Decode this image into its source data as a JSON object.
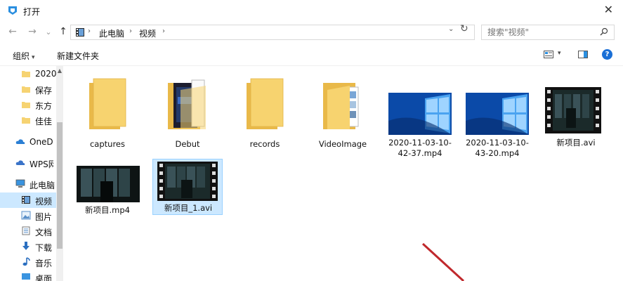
{
  "window": {
    "title": "打开",
    "close_glyph": "✕"
  },
  "nav": {
    "back": "←",
    "forward": "→",
    "recent": "⌄",
    "up": "↑"
  },
  "address": {
    "crumbs": [
      "此电脑",
      "视频"
    ],
    "sep": "›",
    "dropdown": "⌄",
    "refresh": "↻"
  },
  "search": {
    "placeholder": "搜索\"视频\""
  },
  "toolbar": {
    "organize_label": "组织",
    "organize_caret": "▾",
    "new_folder_label": "新建文件夹",
    "view_caret": "▾",
    "help_glyph": "?"
  },
  "sidebar": {
    "items": [
      {
        "label": "2020",
        "icon": "folder-icon"
      },
      {
        "label": "保存",
        "icon": "folder-icon"
      },
      {
        "label": "东方",
        "icon": "folder-icon"
      },
      {
        "label": "佳佳",
        "icon": "folder-icon"
      },
      {
        "label": "OneD",
        "icon": "cloud-icon"
      },
      {
        "label": "WPS网",
        "icon": "cloud-icon"
      },
      {
        "label": "此电脑",
        "icon": "computer-icon"
      },
      {
        "label": "视频",
        "icon": "video-icon",
        "selected": true
      },
      {
        "label": "图片",
        "icon": "picture-icon"
      },
      {
        "label": "文档",
        "icon": "document-icon"
      },
      {
        "label": "下载",
        "icon": "download-icon"
      },
      {
        "label": "音乐",
        "icon": "music-icon"
      },
      {
        "label": "桌面",
        "icon": "desktop-icon"
      }
    ],
    "scroll_up": "▲"
  },
  "files": [
    {
      "name": "captures",
      "type": "folder"
    },
    {
      "name": "Debut",
      "type": "folder-with-content"
    },
    {
      "name": "records",
      "type": "folder"
    },
    {
      "name": "VideoImage",
      "type": "folder-with-content"
    },
    {
      "name_line1": "2020-11-03-10-",
      "name_line2": "42-37.mp4",
      "type": "video-thumbnail-windows"
    },
    {
      "name_line1": "2020-11-03-10-",
      "name_line2": "43-20.mp4",
      "type": "video-thumbnail-windows"
    },
    {
      "name": "新项目.avi",
      "type": "video-thumbnail-joker-film"
    },
    {
      "name": "新项目.mp4",
      "type": "video-thumbnail-joker"
    },
    {
      "name": "新项目_1.avi",
      "type": "video-thumbnail-joker-film",
      "selected": true
    }
  ],
  "colors": {
    "selection": "#cce8ff",
    "folder": "#f6d372",
    "accent": "#1a6fd6",
    "annotation_arrow": "#c0282c"
  }
}
